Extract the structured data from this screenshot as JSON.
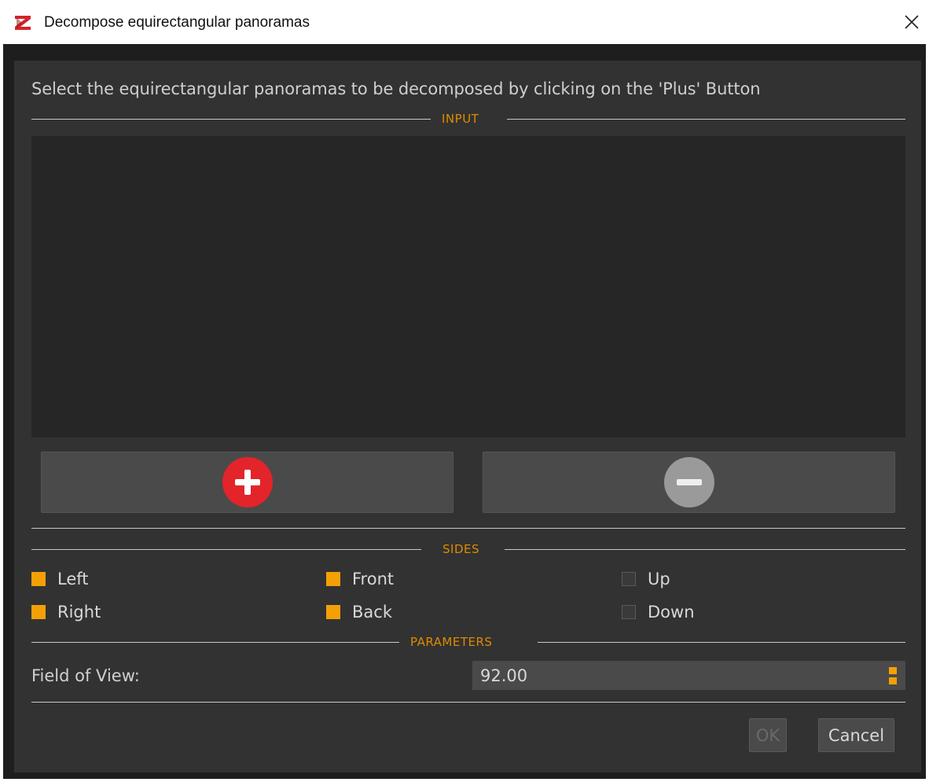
{
  "window": {
    "title": "Decompose equirectangular panoramas",
    "app_icon": "app-logo-icon",
    "close_icon": "close-icon"
  },
  "dialog": {
    "instruction": "Select the equirectangular panoramas to be decomposed by clicking on the 'Plus' Button",
    "sections": {
      "input": "INPUT",
      "sides": "SIDES",
      "parameters": "PARAMETERS"
    },
    "input_list": {
      "items": []
    },
    "buttons": {
      "add_icon": "plus-circle-icon",
      "remove_icon": "minus-circle-icon",
      "ok": "OK",
      "cancel": "Cancel"
    },
    "sides": [
      {
        "label": "Left",
        "checked": true
      },
      {
        "label": "Front",
        "checked": true
      },
      {
        "label": "Up",
        "checked": false
      },
      {
        "label": "Right",
        "checked": true
      },
      {
        "label": "Back",
        "checked": true
      },
      {
        "label": "Down",
        "checked": false
      }
    ],
    "parameters": {
      "fov_label": "Field of View:",
      "fov_value": "92.00"
    }
  },
  "colors": {
    "accent": "#f3a006",
    "add_button": "#e3242b",
    "remove_button": "#9a9a9a",
    "background": "#323232"
  }
}
